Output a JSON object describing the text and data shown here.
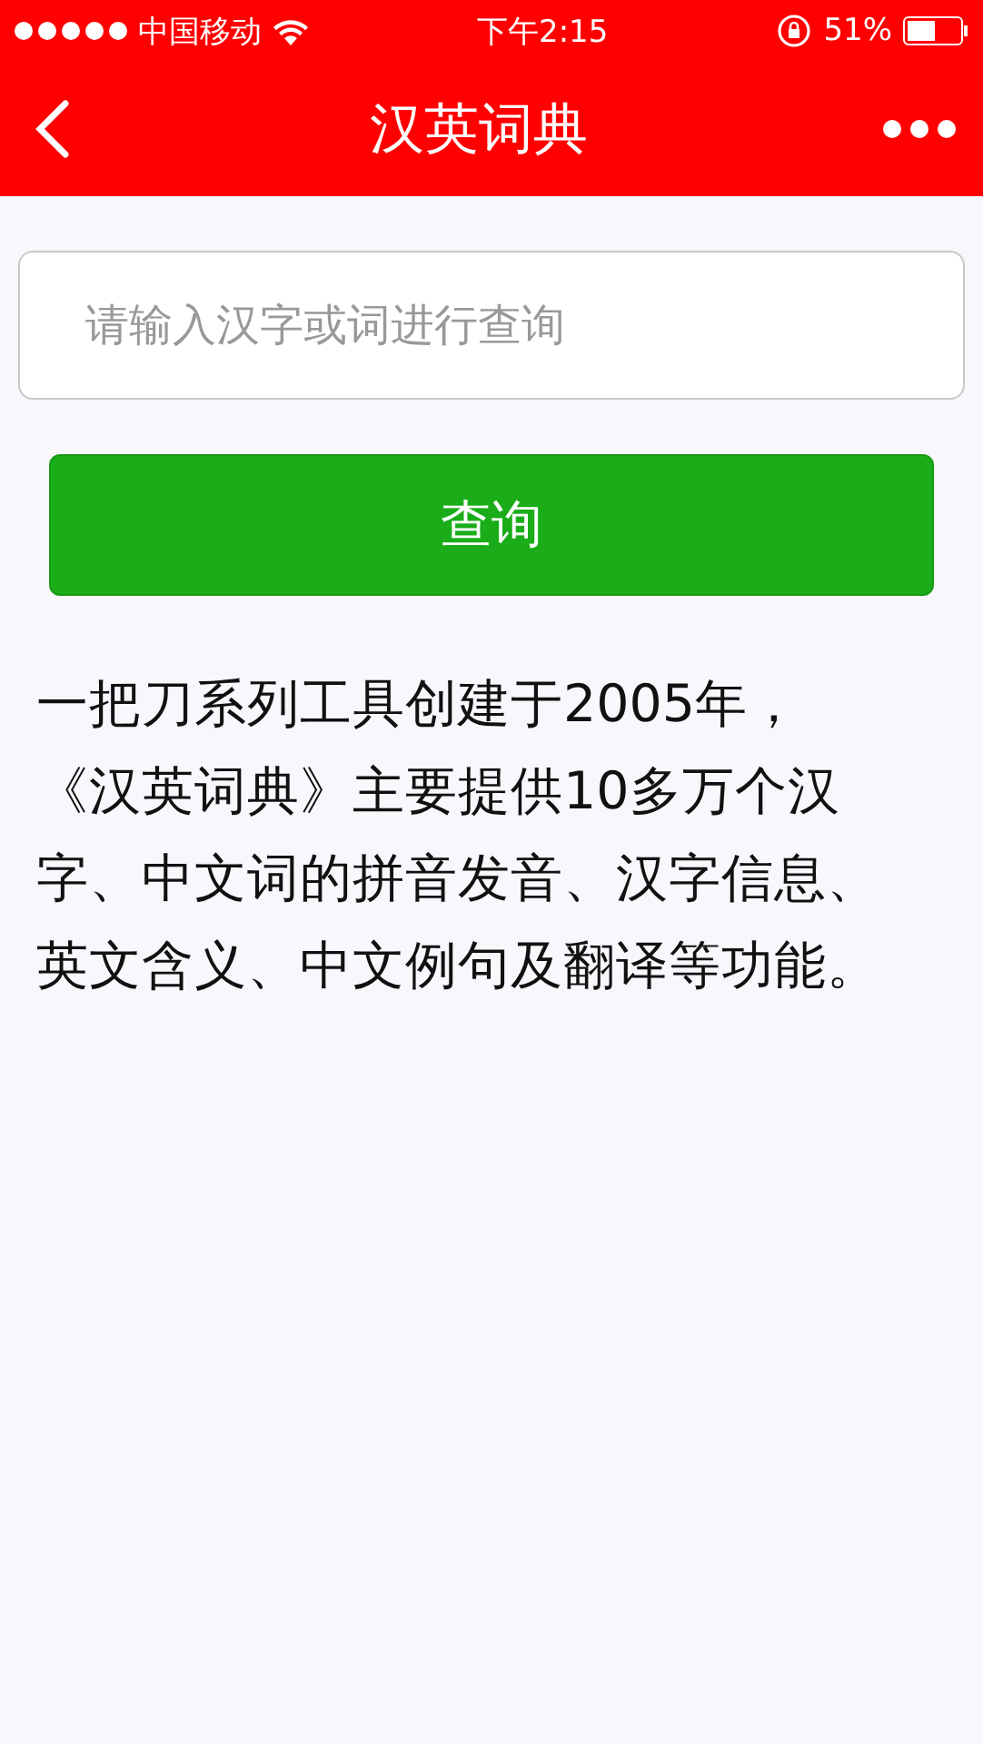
{
  "status_bar": {
    "carrier": "中国移动",
    "time": "下午2:15",
    "battery": "51%"
  },
  "nav_bar": {
    "title": "汉英词典"
  },
  "search": {
    "placeholder": "请输入汉字或词进行查询"
  },
  "query_button": "查询",
  "description": " 一把刀系列工具创建于2005年，《汉英词典》主要提供10多万个汉字、中文词的拼音发音、汉字信息、英文含义、中文例句及翻译等功能。"
}
